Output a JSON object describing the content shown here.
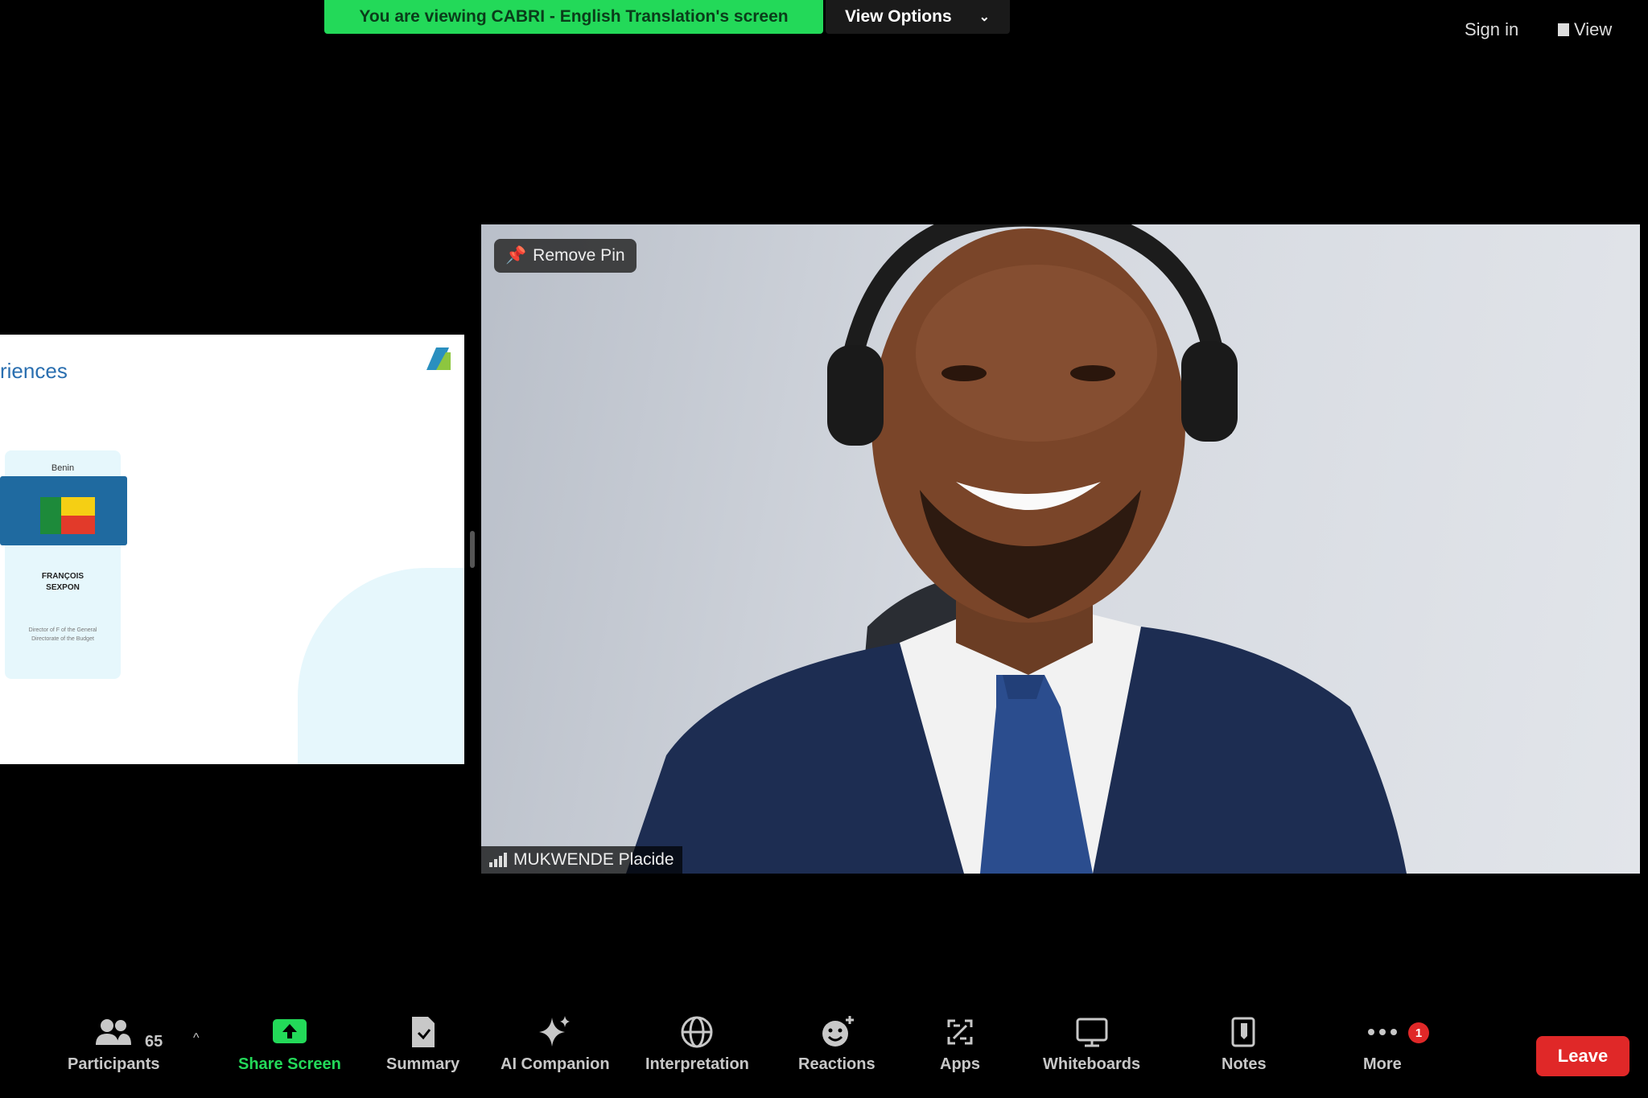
{
  "topbar": {
    "viewing_banner": "You are viewing CABRI - English Translation's screen",
    "view_options": "View Options",
    "sign_in": "Sign in",
    "view": "View"
  },
  "slide": {
    "title_fragment": "riences",
    "card": {
      "country": "Benin",
      "name_line1": "FRANÇOIS",
      "name_line2": "SEXPON",
      "description": "Director of F of the General Directorate of the Budget"
    }
  },
  "video": {
    "remove_pin": "Remove Pin",
    "participant_name": "MUKWENDE Placide"
  },
  "toolbar": {
    "participants": {
      "label": "Participants",
      "count": "65"
    },
    "share_screen": "Share Screen",
    "summary": "Summary",
    "ai_companion": "AI Companion",
    "interpretation": "Interpretation",
    "reactions": "Reactions",
    "apps": "Apps",
    "whiteboards": "Whiteboards",
    "notes": "Notes",
    "more": "More",
    "more_badge": "1",
    "leave": "Leave"
  },
  "colors": {
    "banner_green": "#23d959",
    "leave_red": "#e02828",
    "suit_navy": "#1d2d52"
  }
}
